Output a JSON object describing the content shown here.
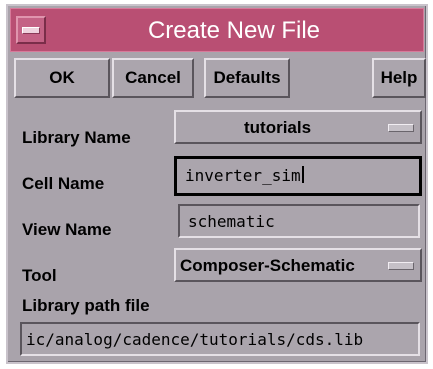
{
  "window": {
    "title": "Create New File"
  },
  "toolbar": {
    "ok_label": "OK",
    "cancel_label": "Cancel",
    "defaults_label": "Defaults",
    "help_label": "Help"
  },
  "form": {
    "library_name": {
      "label": "Library Name",
      "value": "tutorials"
    },
    "cell_name": {
      "label": "Cell Name",
      "value": "inverter_sim"
    },
    "view_name": {
      "label": "View Name",
      "value": "schematic"
    },
    "tool": {
      "label": "Tool",
      "value": "Composer-Schematic"
    },
    "library_path": {
      "label": "Library path file",
      "value": "ic/analog/cadence/tutorials/cds.lib"
    }
  },
  "icons": {
    "window_menu": "window-menu-icon",
    "dropdown": "dropdown-indicator-icon"
  }
}
